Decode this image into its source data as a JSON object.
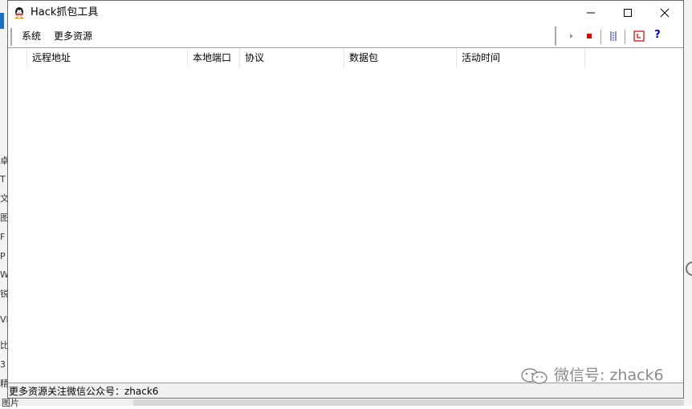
{
  "window": {
    "title": "Hack抓包工具"
  },
  "titlebar_buttons": [
    {
      "name": "minimize-button",
      "icon": "minimize-icon"
    },
    {
      "name": "maximize-button",
      "icon": "maximize-icon"
    },
    {
      "name": "close-button",
      "icon": "close-icon"
    }
  ],
  "menu": {
    "items": [
      {
        "label": "系统"
      },
      {
        "label": "更多资源"
      }
    ]
  },
  "toolbar": {
    "buttons": [
      {
        "icon": "play-icon",
        "enabled": false
      },
      {
        "icon": "stop-icon",
        "color": "#e00000"
      },
      {
        "icon": "columns-icon",
        "color": "#2020a0"
      },
      {
        "icon": "clock-icon",
        "color": "#d00000"
      },
      {
        "icon": "help-icon",
        "label": "?",
        "color": "#0000c0"
      }
    ]
  },
  "table": {
    "columns": [
      "远程地址",
      "本地端口",
      "协议",
      "数据包",
      "活动时间"
    ],
    "rows": []
  },
  "statusbar": {
    "text": "更多资源关注微信公众号：zhack6"
  },
  "watermark": {
    "text": "微信号: zhack6"
  },
  "background": {
    "left_chars": [
      "卓",
      "T",
      "文",
      "图",
      "F",
      "P",
      "W",
      "锐",
      "VI",
      "比",
      "3",
      "精"
    ],
    "bottom_char": "图片"
  }
}
